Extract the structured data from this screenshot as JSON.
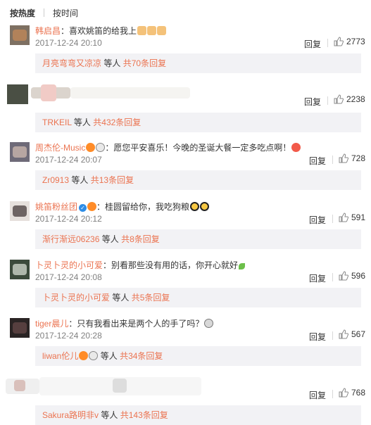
{
  "tabs": {
    "hot": "按热度",
    "time": "按时间"
  },
  "reply_label": "回复",
  "comments": [
    {
      "user": "韩启昌",
      "text": "：喜欢姚笛的给我上",
      "time": "2017-12-24 20:10",
      "likes": "2773",
      "replies": {
        "name": "月亮弯弯又凉凉",
        "mid": "等人",
        "total": "共70条回复"
      }
    },
    {
      "user": "",
      "text": "",
      "time": "",
      "likes": "2238",
      "replies": {
        "name": "TRKEIL",
        "mid": "等人",
        "total": "共432条回复"
      }
    },
    {
      "user": "周杰伦-Music",
      "text": "：愿您平安喜乐！今晚的圣诞大餐一定多吃点啊！",
      "time": "2017-12-24 20:07",
      "likes": "728",
      "replies": {
        "name": "Zr0913",
        "mid": "等人",
        "total": "共13条回复"
      }
    },
    {
      "user": "姚笛粉丝团",
      "text": "：桂圆留给你，我吃狗粮",
      "time": "2017-12-24 20:12",
      "likes": "591",
      "replies": {
        "name": "渐行渐远06236",
        "mid": "等人",
        "total": "共8条回复"
      }
    },
    {
      "user": "卜灵卜灵的小可爱",
      "text": "：别看那些没有用的话，你开心就好",
      "time": "2017-12-24 20:08",
      "likes": "596",
      "replies": {
        "name": "卜灵卜灵的小可爱",
        "mid": "等人",
        "total": "共5条回复"
      }
    },
    {
      "user": "tiger晨儿",
      "text": "：只有我看出来是两个人的手了吗？",
      "time": "2017-12-24 20:28",
      "likes": "567",
      "replies": {
        "name": "liwan伦儿",
        "mid": "等人",
        "total": "共34条回复"
      }
    },
    {
      "user": "",
      "text": "",
      "time": "",
      "likes": "768",
      "replies": {
        "name": "Sakura路明非v",
        "mid": "等人",
        "total": "共143条回复"
      }
    }
  ],
  "colors": {
    "link": "#eb7350",
    "reply_bg": "#f2f2f5",
    "muted": "#808080",
    "text": "#333333"
  },
  "icons": {
    "like": "thumbs-up-icon",
    "verified": "verified-badge-icon"
  }
}
